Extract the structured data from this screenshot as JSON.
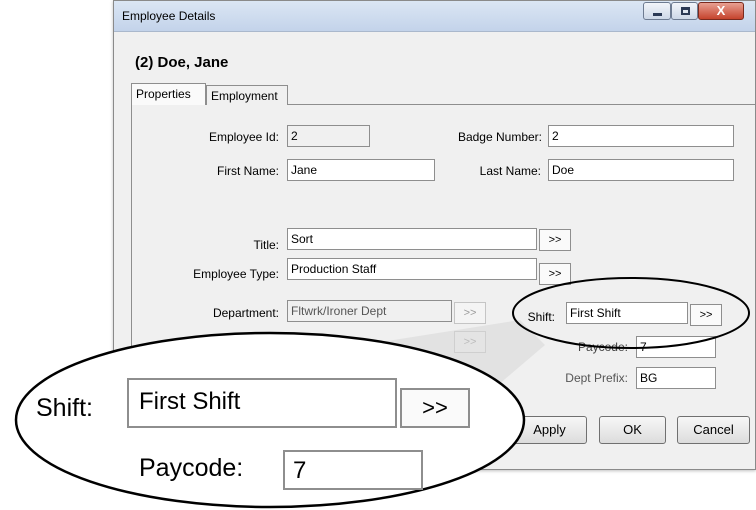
{
  "window": {
    "title": "Employee Details"
  },
  "record": {
    "heading": "(2) Doe, Jane"
  },
  "tabs": [
    {
      "label": "Properties"
    },
    {
      "label": "Employment"
    }
  ],
  "form": {
    "employee_id": {
      "label": "Employee Id:",
      "value": "2"
    },
    "badge_number": {
      "label": "Badge Number:",
      "value": "2"
    },
    "first_name": {
      "label": "First Name:",
      "value": "Jane"
    },
    "last_name": {
      "label": "Last Name:",
      "value": "Doe"
    },
    "title": {
      "label": "Title:",
      "value": "Sort"
    },
    "employee_type": {
      "label": "Employee Type:",
      "value": "Production Staff"
    },
    "department": {
      "label": "Department:",
      "value": "Fltwrk/Ironer Dept"
    },
    "shift": {
      "label": "Shift:",
      "value": "First Shift"
    },
    "paycode": {
      "label": "Paycode:",
      "value": "7"
    },
    "dept_prefix": {
      "label": "Dept Prefix:",
      "value": "BG"
    },
    "picker_label": ">>"
  },
  "buttons": {
    "apply": "Apply",
    "ok": "OK",
    "cancel": "Cancel"
  },
  "zoom": {
    "shift_label": "Shift:",
    "shift_value": "First Shift",
    "picker_label": ">>",
    "paycode_label": "Paycode:",
    "paycode_value": "7"
  }
}
